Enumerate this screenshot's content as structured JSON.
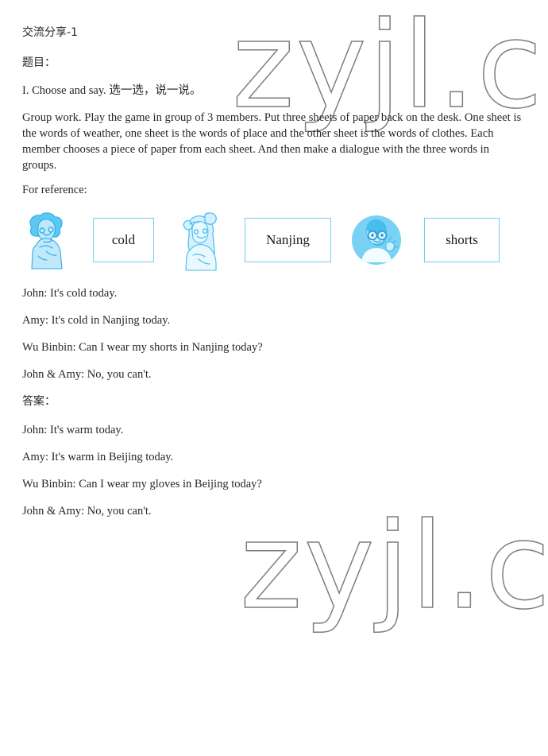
{
  "watermark": {
    "text": "zyjl.cn",
    "color": "#7d7d7d"
  },
  "header": {
    "title": "交流分享-1",
    "section_label": "题目："
  },
  "task": {
    "instruction_heading": "I. Choose and say. 选一选，说一说。",
    "description": "Group work. Play the game in group of 3 members. Put three sheets of paper back on the desk. One sheet is the words of weather, one sheet is the words of place and the other sheet is the words of clothes. Each member chooses a piece of paper from each sheet. And then make a dialogue with the three words in groups.",
    "reference_label": "For reference:"
  },
  "reference_row": {
    "items": [
      {
        "kind": "illustration",
        "name": "boy-curly-hair",
        "label": ""
      },
      {
        "kind": "word-card",
        "name": "word-card-cold",
        "label": "cold"
      },
      {
        "kind": "illustration",
        "name": "girl-with-bow",
        "label": ""
      },
      {
        "kind": "word-card",
        "name": "word-card-nanjing",
        "label": "Nanjing"
      },
      {
        "kind": "illustration",
        "name": "boy-with-glasses-avatar",
        "label": ""
      },
      {
        "kind": "word-card",
        "name": "word-card-shorts",
        "label": "shorts"
      }
    ],
    "card_border_color": "#73cdf2",
    "illustration_color": "#4ec3f0"
  },
  "example_dialogue": {
    "lines": [
      "John: It's cold today.",
      "Amy: It's cold in Nanjing today.",
      "Wu Binbin: Can I wear my shorts in Nanjing today?",
      "John & Amy: No, you can't."
    ]
  },
  "answer": {
    "label": "答案：",
    "lines": [
      "John: It's warm today.",
      "Amy: It's warm in Beijing today.",
      "Wu Binbin: Can I wear my gloves in Beijing today?",
      "John & Amy: No, you can't."
    ]
  }
}
